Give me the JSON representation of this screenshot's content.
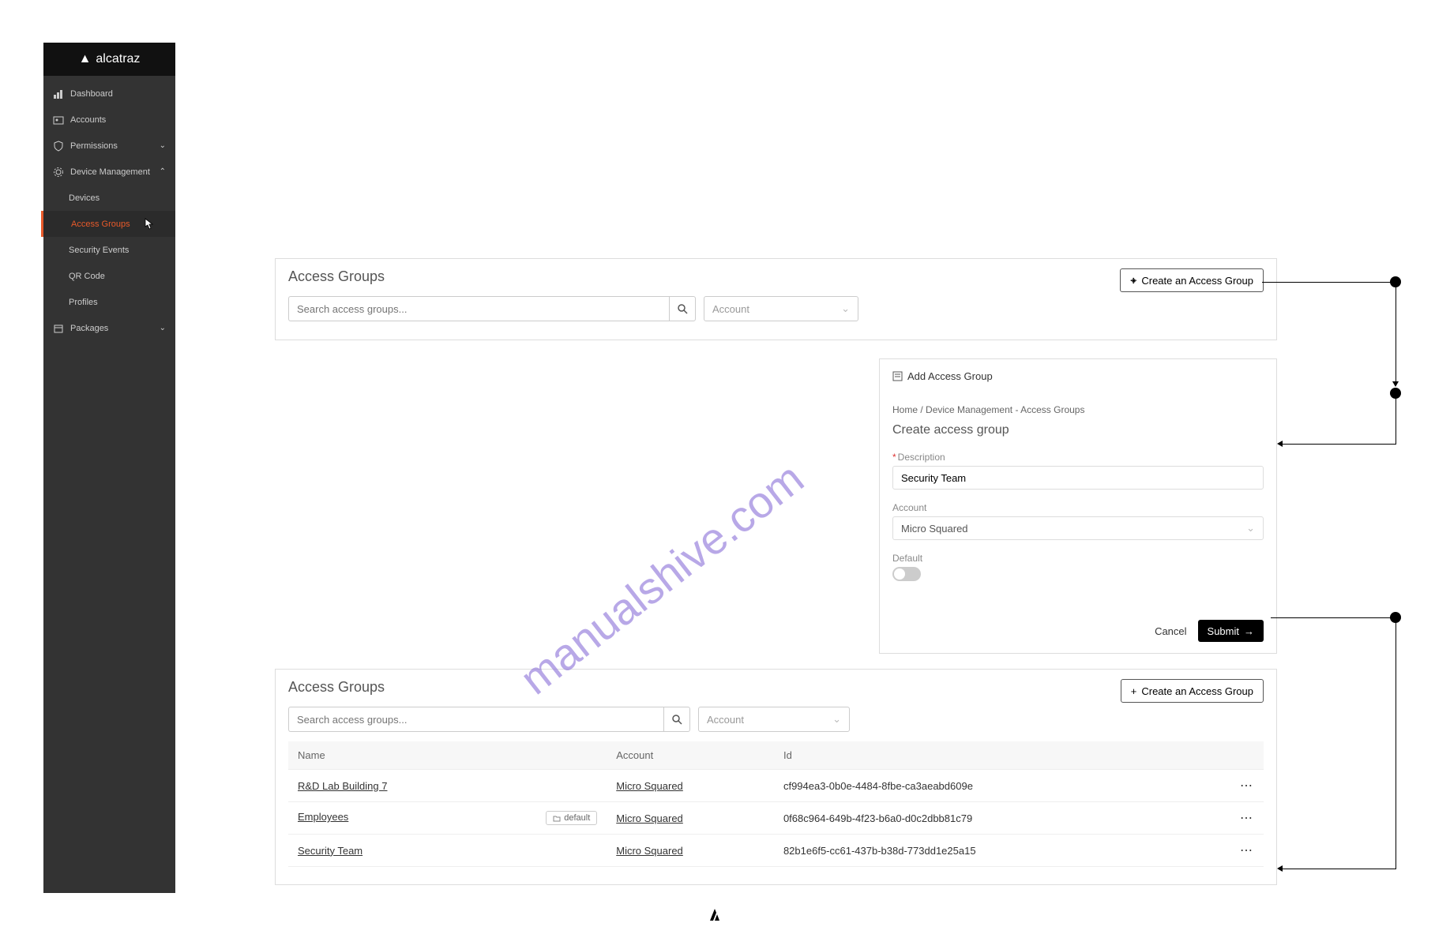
{
  "brand": "alcatraz",
  "sidebar": {
    "items": [
      {
        "label": "Dashboard"
      },
      {
        "label": "Accounts"
      },
      {
        "label": "Permissions"
      },
      {
        "label": "Device Management"
      }
    ],
    "subitems": [
      {
        "label": "Devices"
      },
      {
        "label": "Access Groups"
      },
      {
        "label": "Security Events"
      },
      {
        "label": "QR Code"
      },
      {
        "label": "Profiles"
      }
    ],
    "packages": "Packages"
  },
  "panel1": {
    "title": "Access Groups",
    "search_placeholder": "Search access groups...",
    "account_placeholder": "Account",
    "create_btn": "Create an Access Group"
  },
  "form": {
    "header": "Add Access Group",
    "breadcrumb_home": "Home",
    "breadcrumb_sep": "/",
    "breadcrumb_tail": "Device Management - Access Groups",
    "title": "Create access group",
    "desc_label": "Description",
    "desc_value": "Security Team",
    "account_label": "Account",
    "account_value": "Micro Squared",
    "default_label": "Default",
    "cancel": "Cancel",
    "submit": "Submit"
  },
  "panel3": {
    "title": "Access Groups",
    "search_placeholder": "Search access groups...",
    "account_placeholder": "Account",
    "create_btn": "Create an Access Group",
    "cols": {
      "name": "Name",
      "account": "Account",
      "id": "Id"
    },
    "default_chip": "default",
    "rows": [
      {
        "name": "R&D Lab Building 7",
        "account": "Micro Squared",
        "id": "cf994ea3-0b0e-4484-8fbe-ca3aeabd609e"
      },
      {
        "name": "Employees",
        "account": "Micro Squared",
        "id": "0f68c964-649b-4f23-b6a0-d0c2dbb81c79",
        "default": true
      },
      {
        "name": "Security Team",
        "account": "Micro Squared",
        "id": "82b1e6f5-cc61-437b-b38d-773dd1e25a15"
      }
    ]
  },
  "watermark": "manualshive.com"
}
